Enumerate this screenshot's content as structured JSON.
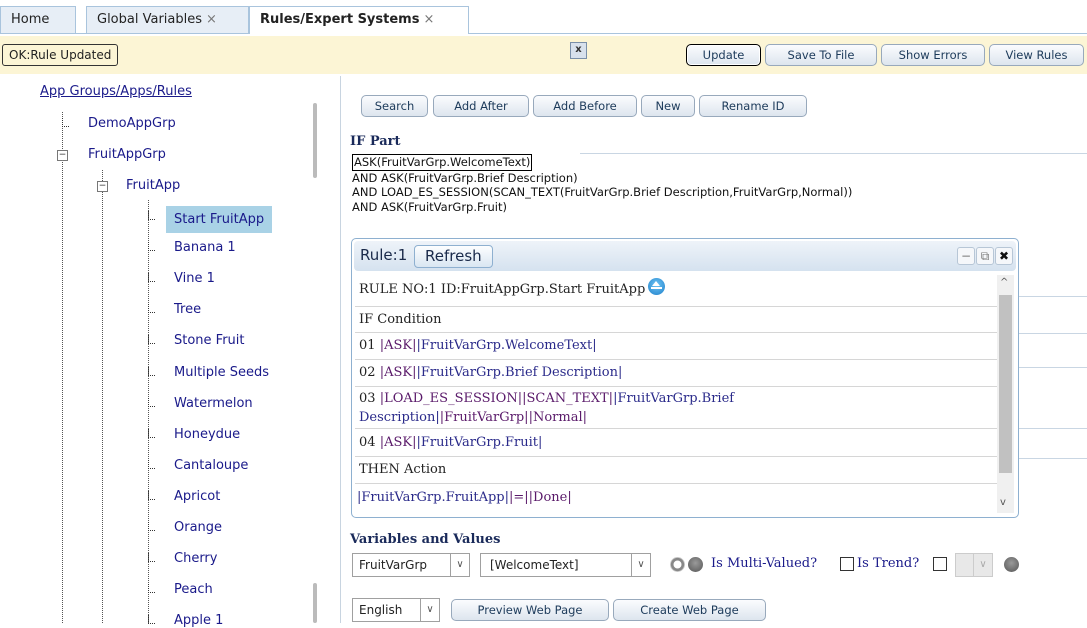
{
  "tabs": [
    {
      "label": "Home",
      "closable": false,
      "active": false
    },
    {
      "label": "Global Variables",
      "closable": true,
      "active": false
    },
    {
      "label": "Rules/Expert Systems",
      "closable": true,
      "active": true
    }
  ],
  "tab_close_glyph": "×",
  "status": {
    "message": "OK:Rule Updated",
    "close_glyph": "x"
  },
  "toolbar": {
    "update": "Update",
    "save_to_file": "Save To File",
    "show_errors": "Show Errors",
    "view_rules": "View Rules"
  },
  "tree": {
    "title": "App Groups/Apps/Rules",
    "group1": "DemoAppGrp",
    "group2": "FruitAppGrp",
    "app": "FruitApp",
    "expander_glyph": "−",
    "rules": [
      "Start FruitApp",
      "Banana 1",
      "Vine 1",
      "Tree",
      "Stone Fruit",
      "Multiple Seeds",
      "Watermelon",
      "Honeydue",
      "Cantaloupe",
      "Apricot",
      "Orange",
      "Cherry",
      "Peach",
      "Apple 1"
    ],
    "selected_rule": "Start FruitApp"
  },
  "rule_actions": {
    "search": "Search",
    "add_after": "Add After",
    "add_before": "Add Before",
    "new": "New",
    "rename_id": "Rename ID"
  },
  "if_part": {
    "label": "IF Part",
    "lines": [
      "ASK(FruitVarGrp.WelcomeText)",
      "AND ASK(FruitVarGrp.Brief Description)",
      "AND LOAD_ES_SESSION(SCAN_TEXT(FruitVarGrp.Brief Description,FruitVarGrp,Normal))",
      "AND ASK(FruitVarGrp.Fruit)"
    ]
  },
  "rule_panel": {
    "title": "Rule:1",
    "refresh": "Refresh",
    "minimize_glyph": "−",
    "popout_glyph": "⧉",
    "close_glyph": "✖",
    "header": "RULE NO:1 ID:FruitAppGrp.Start FruitApp",
    "if_condition": "IF Condition",
    "conditions": [
      {
        "num": "01",
        "parts": [
          "|ASK|",
          "|FruitVarGrp.WelcomeText|"
        ]
      },
      {
        "num": "02",
        "parts": [
          "|ASK|",
          "|FruitVarGrp.Brief Description|"
        ]
      },
      {
        "num": "03",
        "parts": [
          "|LOAD_ES_SESSION|",
          "|SCAN_TEXT|",
          "|FruitVarGrp.Brief",
          "Description|",
          "|FruitVarGrp|",
          "|Normal|"
        ]
      },
      {
        "num": "04",
        "parts": [
          "|ASK|",
          "|FruitVarGrp.Fruit|"
        ]
      }
    ],
    "then_action": "THEN Action",
    "action": [
      "|FruitVarGrp.FruitApp|",
      "|=|",
      "|Done|"
    ],
    "scroll_up_glyph": "^",
    "scroll_down_glyph": "v"
  },
  "variables": {
    "label": "Variables and Values",
    "group_select": "FruitVarGrp",
    "var_select": "[WelcomeText]",
    "dropdown_glyph": "∨",
    "is_multi_valued": "Is Multi-Valued?",
    "is_trend": "Is Trend?"
  },
  "bottom": {
    "language": "English",
    "preview_web_page": "Preview Web Page",
    "create_web_page": "Create Web Page"
  },
  "colors": {
    "tab_border": "#a9c4dd",
    "status_bg": "#fcf5d5",
    "selected_bg": "#a9d2e6",
    "link": "#1a1a8a"
  }
}
